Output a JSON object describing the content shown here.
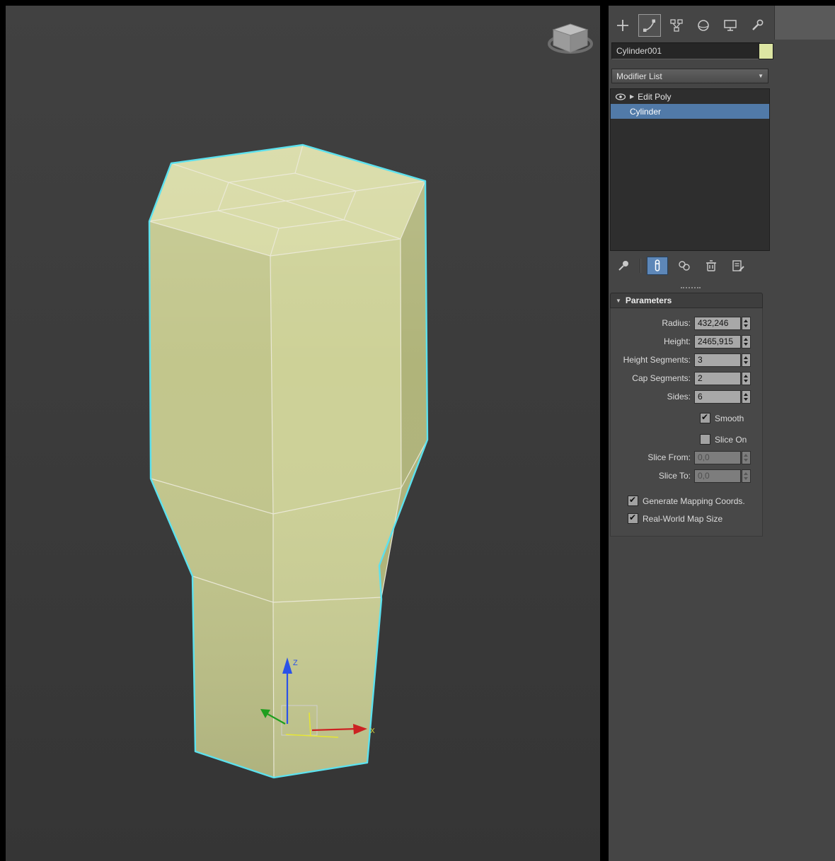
{
  "colors": {
    "selection_blue": "#517aa8",
    "tool_active_blue": "#5d87b8",
    "object_cap": "#d6d9a2",
    "object_side_light": "#cdd197",
    "object_side_mid": "#c2c68c",
    "object_side_dark": "#b0b47a",
    "selection_outline": "#5ce1ee",
    "object_swatch": "#dde6a3",
    "axis_x": "#cc2222",
    "axis_y": "#1f9e1f",
    "axis_z": "#2a52e8"
  },
  "icons": {
    "tabs": [
      "create-plus-icon",
      "modify-curve-icon",
      "hierarchy-icon",
      "motion-icon",
      "display-monitor-icon",
      "utilities-wrench-icon"
    ],
    "stack": [
      "eye-icon",
      "expand-arrow-icon"
    ],
    "stack_tools": [
      "pin-icon",
      "show-end-result-icon",
      "make-unique-icon",
      "trash-icon",
      "configure-sets-icon"
    ],
    "dropdown": "chevron-down-icon"
  },
  "viewport": {
    "axis_labels": {
      "z": "Z",
      "x": "X"
    }
  },
  "command_panel": {
    "tabs": [
      {
        "name": "create",
        "selected": false
      },
      {
        "name": "modify",
        "selected": true
      },
      {
        "name": "hierarchy",
        "selected": false
      },
      {
        "name": "motion",
        "selected": false
      },
      {
        "name": "display",
        "selected": false
      },
      {
        "name": "utilities",
        "selected": false
      }
    ],
    "object_name": "Cylinder001",
    "modifier_list": {
      "label": "Modifier List"
    },
    "modifier_stack": {
      "items": [
        {
          "label": "Edit Poly",
          "selected": false
        },
        {
          "label": "Cylinder",
          "selected": true
        }
      ]
    },
    "stack_tools": [
      {
        "name": "pin-stack",
        "active": false
      },
      {
        "name": "show-end-result",
        "active": true
      },
      {
        "name": "make-unique",
        "active": false
      },
      {
        "name": "remove-modifier",
        "active": false
      },
      {
        "name": "configure-modifier-sets",
        "active": false
      }
    ],
    "rollout": {
      "title": "Parameters",
      "spinners": [
        {
          "label": "Radius:",
          "value": "432,246",
          "disabled": false
        },
        {
          "label": "Height:",
          "value": "2465,915",
          "disabled": false
        },
        {
          "label": "Height Segments:",
          "value": "3",
          "disabled": false
        },
        {
          "label": "Cap Segments:",
          "value": "2",
          "disabled": false
        },
        {
          "label": "Sides:",
          "value": "6",
          "disabled": false
        }
      ],
      "checks": [
        {
          "label": "Smooth",
          "checked": true
        },
        {
          "label": "Slice On",
          "checked": false
        }
      ],
      "slice_spinners": [
        {
          "label": "Slice From:",
          "value": "0,0",
          "disabled": true
        },
        {
          "label": "Slice To:",
          "value": "0,0",
          "disabled": true
        }
      ],
      "mapping_checks": [
        {
          "label": "Generate Mapping Coords.",
          "checked": true
        },
        {
          "label": "Real-World Map Size",
          "checked": true
        }
      ]
    }
  }
}
